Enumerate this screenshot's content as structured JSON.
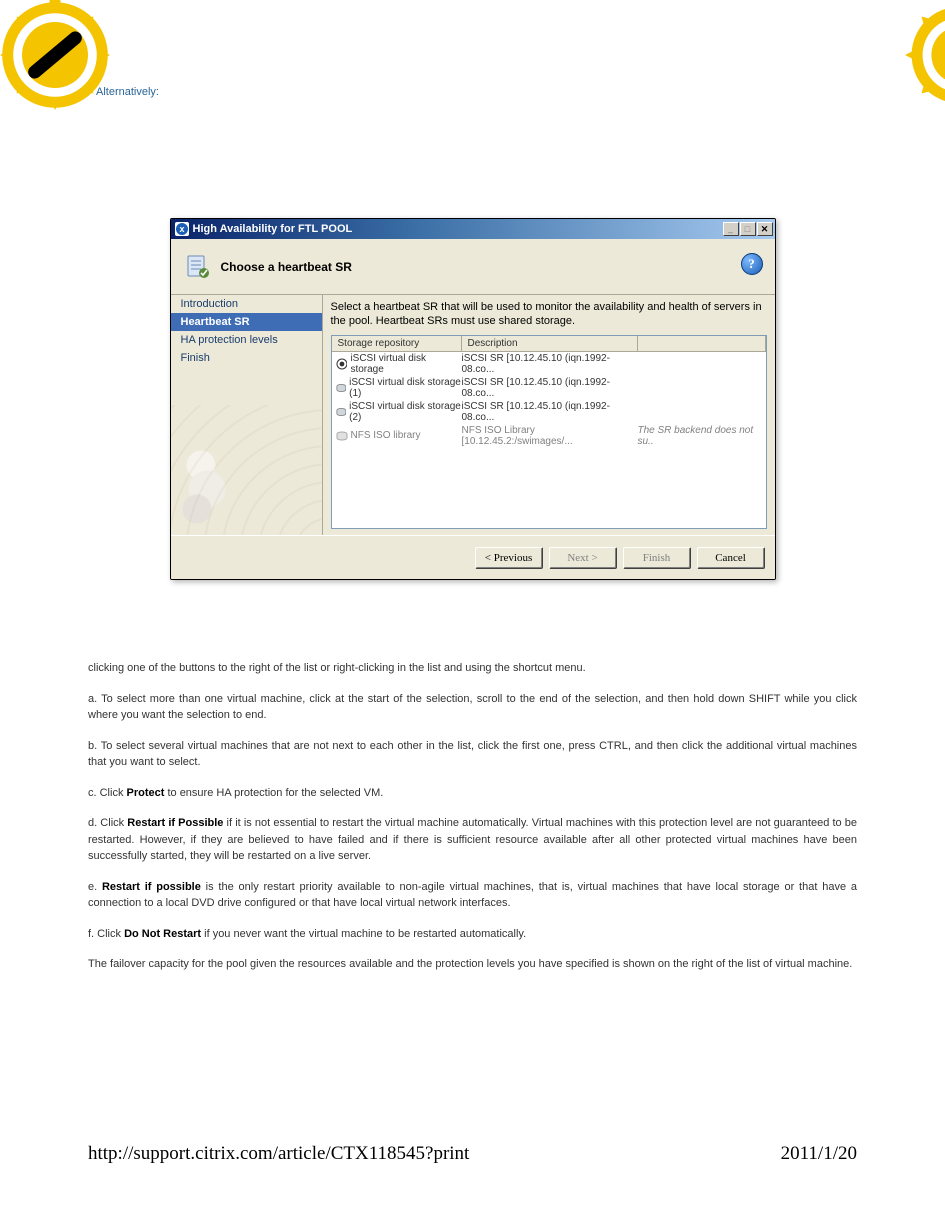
{
  "page": {
    "alt_text": "Alternatively:",
    "frag_intro": "clicking one of the buttons to the right of the list or right-clicking in the list and using the shortcut menu.",
    "para_a": "a. To select more than one virtual machine, click at the start of the selection, scroll to the end of the selection, and then hold down SHIFT while you click where you want the selection to end.",
    "para_b": "b. To select several virtual machines that are not next to each other in the list, click the first one, press CTRL, and then click the additional virtual machines that you want to select.",
    "para_c_pre": "c. Click ",
    "para_c_bold": "Protect",
    "para_c_post": " to ensure HA protection for the selected VM.",
    "para_d_pre": "d. Click ",
    "para_d_bold": "Restart if Possible",
    "para_d_post": " if it is not essential to restart the virtual machine automatically. Virtual machines with this protection level are not guaranteed to be restarted. However, if they are believed to have failed and if there is sufficient resource available after all other protected virtual machines have been successfully started, they will be restarted on a live server.",
    "para_e_pre": "e. ",
    "para_e_bold": "Restart if possible",
    "para_e_post": " is the only restart priority available to non-agile virtual machines, that is, virtual machines that have local storage or that have a connection to a local DVD drive configured or that have local virtual network interfaces.",
    "para_f_pre": "f. Click ",
    "para_f_bold": "Do Not Restart",
    "para_f_post": " if you never want the virtual machine to be restarted automatically.",
    "para_fail": "The failover capacity for the pool given the resources available and the protection levels you have specified is shown on the right of the list of virtual machine.",
    "footer_url": "http://support.citrix.com/article/CTX118545?print",
    "footer_date": "2011/1/20"
  },
  "dialog": {
    "title": "High Availability for FTL POOL",
    "header": "Choose a heartbeat SR",
    "help_glyph": "?",
    "instruction": "Select a heartbeat SR that will be used to monitor the availability and health of servers in the pool. Heartbeat SRs must use shared storage.",
    "nav": {
      "items": [
        {
          "label": "Introduction",
          "selected": false
        },
        {
          "label": "Heartbeat SR",
          "selected": true
        },
        {
          "label": "HA protection levels",
          "selected": false
        },
        {
          "label": "Finish",
          "selected": false
        }
      ]
    },
    "columns": {
      "c1": "Storage repository",
      "c2": "Description"
    },
    "rows": [
      {
        "name": "iSCSI virtual disk storage",
        "desc": "iSCSI SR [10.12.45.10 (iqn.1992-08.co...",
        "note": "",
        "icon": "radio-selected",
        "disabled": false
      },
      {
        "name": "iSCSI virtual disk storage (1)",
        "desc": "iSCSI SR [10.12.45.10 (iqn.1992-08.co...",
        "note": "",
        "icon": "disk",
        "disabled": false
      },
      {
        "name": "iSCSI virtual disk storage (2)",
        "desc": "iSCSI SR [10.12.45.10 (iqn.1992-08.co...",
        "note": "",
        "icon": "disk",
        "disabled": false
      },
      {
        "name": "NFS ISO library",
        "desc": "NFS ISO Library [10.12.45.2:/swimages/...",
        "note": "The SR backend does not su..",
        "icon": "disk",
        "disabled": true
      }
    ],
    "buttons": {
      "prev": "< Previous",
      "next": "Next >",
      "finish": "Finish",
      "cancel": "Cancel"
    },
    "window_controls": {
      "min": "_",
      "max": "□",
      "close": "✕"
    }
  },
  "colors": {
    "link_blue": "#2a6496",
    "title_grad_dark": "#0a246a",
    "title_grad_light": "#a6caf0",
    "ui_face": "#ece9d8",
    "selection": "#3e6db6",
    "badge_yellow": "#f5c400"
  }
}
